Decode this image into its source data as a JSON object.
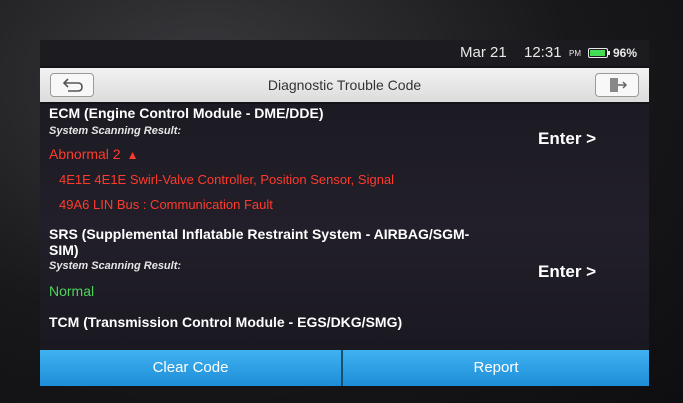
{
  "status_bar": {
    "date": "Mar 21",
    "time": "12:31",
    "ampm": "PM",
    "battery_percent": "96%",
    "battery_level": 0.96
  },
  "header": {
    "title": "Diagnostic Trouble Code"
  },
  "modules": [
    {
      "name": "ECM (Engine Control Module - DME/DDE)",
      "scan_label": "System Scanning Result:",
      "result": "Abnormal 2",
      "enter_label": "Enter >",
      "codes": [
        "4E1E 4E1E Swirl-Valve Controller, Position Sensor, Signal",
        "49A6 LIN Bus : Communication Fault"
      ]
    },
    {
      "name_line1": "SRS (Supplemental Inflatable Restraint System - AIRBAG/SGM-",
      "name_line2": "SIM)",
      "scan_label": "System Scanning Result:",
      "result": "Normal",
      "enter_label": "Enter >"
    },
    {
      "name": "TCM (Transmission Control Module - EGS/DKG/SMG)"
    }
  ],
  "footer": {
    "clear_label": "Clear Code",
    "report_label": "Report"
  },
  "colors": {
    "accent": "#2aa0e6",
    "error": "#ff3b2b",
    "ok": "#4bd65a"
  },
  "icons": {
    "back": "back-arrow-icon",
    "exit": "exit-door-icon",
    "caret": "caret-up-icon",
    "battery": "battery-icon"
  }
}
